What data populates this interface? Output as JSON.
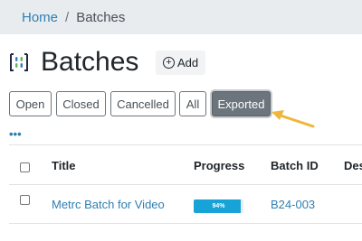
{
  "breadcrumb": {
    "home": "Home",
    "separator": "/",
    "current": "Batches"
  },
  "header": {
    "title": "Batches",
    "add_label": "Add",
    "logo_icon": "batches-logo-icon"
  },
  "filters": [
    {
      "label": "Open"
    },
    {
      "label": "Closed"
    },
    {
      "label": "Cancelled"
    },
    {
      "label": "All"
    },
    {
      "label": "Exported",
      "active": true
    }
  ],
  "more_icon": "•••",
  "table": {
    "columns": [
      "Title",
      "Progress",
      "Batch ID",
      "Des"
    ],
    "rows": [
      {
        "title": "Metrc Batch for Video",
        "progress": 0.94,
        "progress_label": "94%",
        "batch_id": "B24-003"
      }
    ]
  },
  "colors": {
    "link": "#2f7fb0",
    "active_filter": "#6c757d",
    "progress": "#17a2d8",
    "annotation_arrow": "#f0b63a"
  }
}
